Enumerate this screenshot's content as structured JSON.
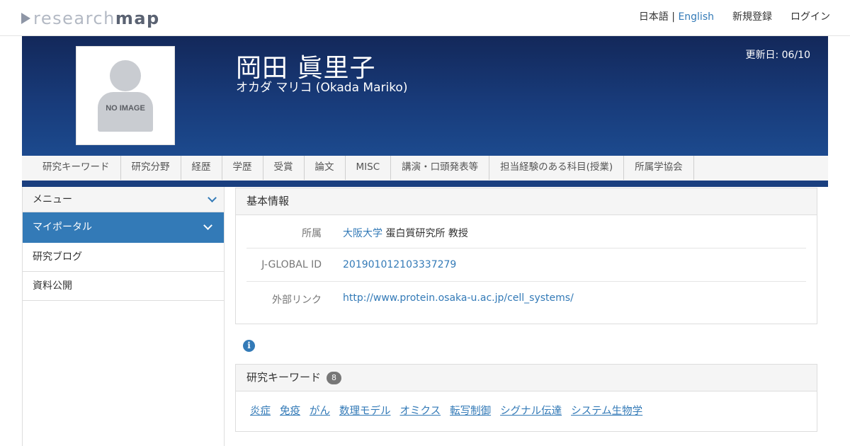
{
  "topbar": {
    "logo_research": "research",
    "logo_map": "map",
    "lang_ja": "日本語",
    "lang_sep": " | ",
    "lang_en": "English",
    "register": "新規登録",
    "login": "ログイン"
  },
  "profile": {
    "photo_text": "NO IMAGE",
    "name": "岡田 眞里子",
    "name_kana": "オカダ マリコ  (Okada Mariko)",
    "updated": "更新日: 06/10"
  },
  "tabs": [
    "研究キーワード",
    "研究分野",
    "経歴",
    "学歴",
    "受賞",
    "論文",
    "MISC",
    "講演・口頭発表等",
    "担当経験のある科目(授業)",
    "所属学協会"
  ],
  "sidebar": {
    "menu_label": "メニュー",
    "active_item": "マイポータル",
    "items": [
      "研究ブログ",
      "資料公開"
    ]
  },
  "basic_info": {
    "title": "基本情報",
    "affiliation_label": "所属",
    "affiliation_link": "大阪大学",
    "affiliation_rest": " 蛋白質研究所 教授",
    "jglobal_label": "J-GLOBAL ID",
    "jglobal_value": "201901012103337279",
    "external_label": "外部リンク",
    "external_value": "http://www.protein.osaka-u.ac.jp/cell_systems/"
  },
  "keywords": {
    "title": "研究キーワード",
    "count": "8",
    "items": [
      "炎症",
      "免疫",
      "がん",
      "数理モデル",
      "オミクス",
      "転写制御",
      "シグナル伝達",
      "システム生物学"
    ]
  },
  "colors": {
    "accent": "#337ab7",
    "header_dark": "#13285a",
    "header_light": "#1c4a8e"
  }
}
